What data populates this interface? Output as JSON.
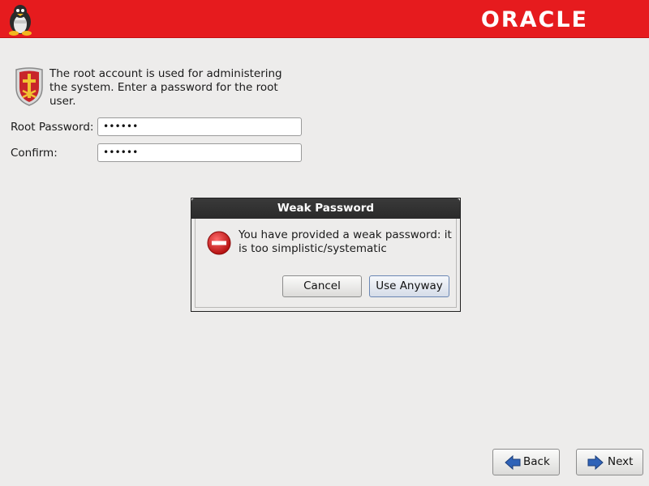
{
  "header": {
    "brand": "ORACLE",
    "logo_icon": "tux-penguin-icon",
    "bar_color": "#e61b1e"
  },
  "intro": {
    "icon": "shield-crest-icon",
    "text": "The root account is used for administering the system.  Enter a password for the root user."
  },
  "form": {
    "root_password_label": "Root Password:",
    "root_password_value": "••••••",
    "confirm_label": "Confirm:",
    "confirm_value": "••••••"
  },
  "dialog": {
    "title": "Weak Password",
    "icon": "error-icon",
    "message": "You have provided a weak password: it is too simplistic/systematic",
    "cancel_label": "Cancel",
    "use_anyway_label": "Use Anyway"
  },
  "navigation": {
    "back_label": "Back",
    "next_label": "Next",
    "back_icon": "arrow-left-icon",
    "next_icon": "arrow-right-icon"
  }
}
